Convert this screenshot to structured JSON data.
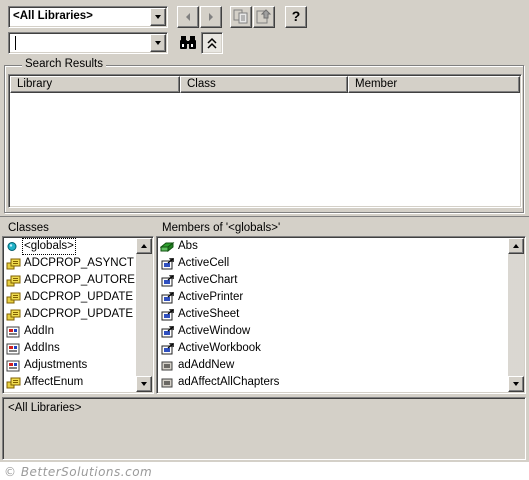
{
  "toolbar": {
    "library_combo_value": "<All Libraries>",
    "search_combo_value": "",
    "back_icon": "arrow-left-icon",
    "forward_icon": "arrow-right-icon",
    "copy_icon": "copy-icon",
    "view_definition_icon": "view-definition-icon",
    "help_label": "?",
    "search_icon": "binoculars-icon",
    "toggle_icon": "chevron-up-double-icon"
  },
  "search_results": {
    "title": "Search Results",
    "columns": [
      "Library",
      "Class",
      "Member"
    ]
  },
  "classes": {
    "title": "Classes",
    "items": [
      {
        "label": "<globals>",
        "icon": "globals-icon",
        "selected": true
      },
      {
        "label": "ADCPROP_ASYNCT",
        "icon": "enum-icon"
      },
      {
        "label": "ADCPROP_AUTORE",
        "icon": "enum-icon"
      },
      {
        "label": "ADCPROP_UPDATE",
        "icon": "enum-icon"
      },
      {
        "label": "ADCPROP_UPDATE",
        "icon": "enum-icon"
      },
      {
        "label": "AddIn",
        "icon": "class-icon"
      },
      {
        "label": "AddIns",
        "icon": "class-icon"
      },
      {
        "label": "Adjustments",
        "icon": "class-icon"
      },
      {
        "label": "AffectEnum",
        "icon": "enum-icon"
      }
    ]
  },
  "members": {
    "title": "Members of '<globals>'",
    "items": [
      {
        "label": "Abs",
        "icon": "method-icon"
      },
      {
        "label": "ActiveCell",
        "icon": "property-icon"
      },
      {
        "label": "ActiveChart",
        "icon": "property-icon"
      },
      {
        "label": "ActivePrinter",
        "icon": "property-icon"
      },
      {
        "label": "ActiveSheet",
        "icon": "property-icon"
      },
      {
        "label": "ActiveWindow",
        "icon": "property-icon"
      },
      {
        "label": "ActiveWorkbook",
        "icon": "property-icon"
      },
      {
        "label": "adAddNew",
        "icon": "constant-icon"
      },
      {
        "label": "adAffectAllChapters",
        "icon": "constant-icon"
      }
    ]
  },
  "details": {
    "text": "<All Libraries>"
  },
  "watermark": "© BetterSolutions.com"
}
